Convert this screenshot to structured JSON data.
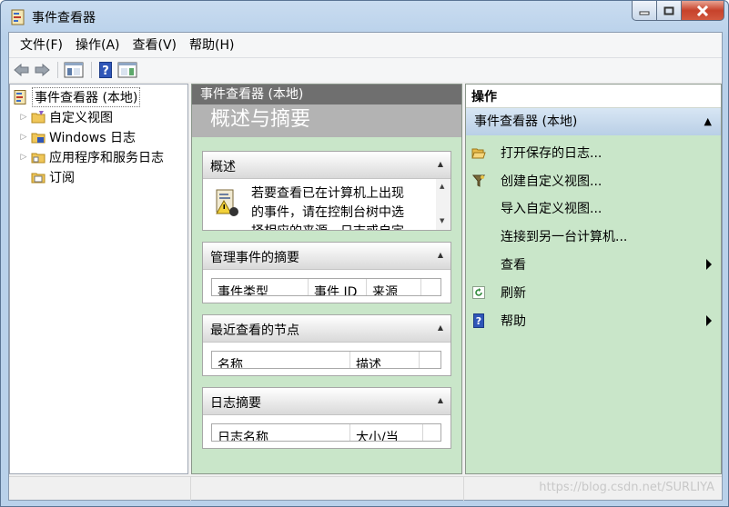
{
  "window": {
    "title": "事件查看器"
  },
  "menu": [
    "文件(F)",
    "操作(A)",
    "查看(V)",
    "帮助(H)"
  ],
  "tree": {
    "root": "事件查看器 (本地)",
    "items": [
      "自定义视图",
      "Windows 日志",
      "应用程序和服务日志",
      "订阅"
    ]
  },
  "middle": {
    "header": "事件查看器 (本地)",
    "title": "概述与摘要",
    "sections": {
      "overview": {
        "title": "概述",
        "text": [
          "若要查看已在计算机上出现",
          "的事件，请在控制台树中选",
          "择相应的来源、日志或自定"
        ]
      },
      "admin": {
        "title": "管理事件的摘要",
        "columns": [
          "事件类型",
          "事件 ID",
          "来源"
        ]
      },
      "recent": {
        "title": "最近查看的节点",
        "columns": [
          "名称",
          "描述"
        ]
      },
      "logs": {
        "title": "日志摘要",
        "columns": [
          "日志名称",
          "大小/当"
        ]
      }
    }
  },
  "actions": {
    "header": "操作",
    "group": "事件查看器 (本地)",
    "items": [
      "打开保存的日志...",
      "创建自定义视图...",
      "导入自定义视图...",
      "连接到另一台计算机...",
      "查看",
      "刷新",
      "帮助"
    ]
  },
  "status": {
    "watermark": "https://blog.csdn.net/SURLIYA"
  }
}
